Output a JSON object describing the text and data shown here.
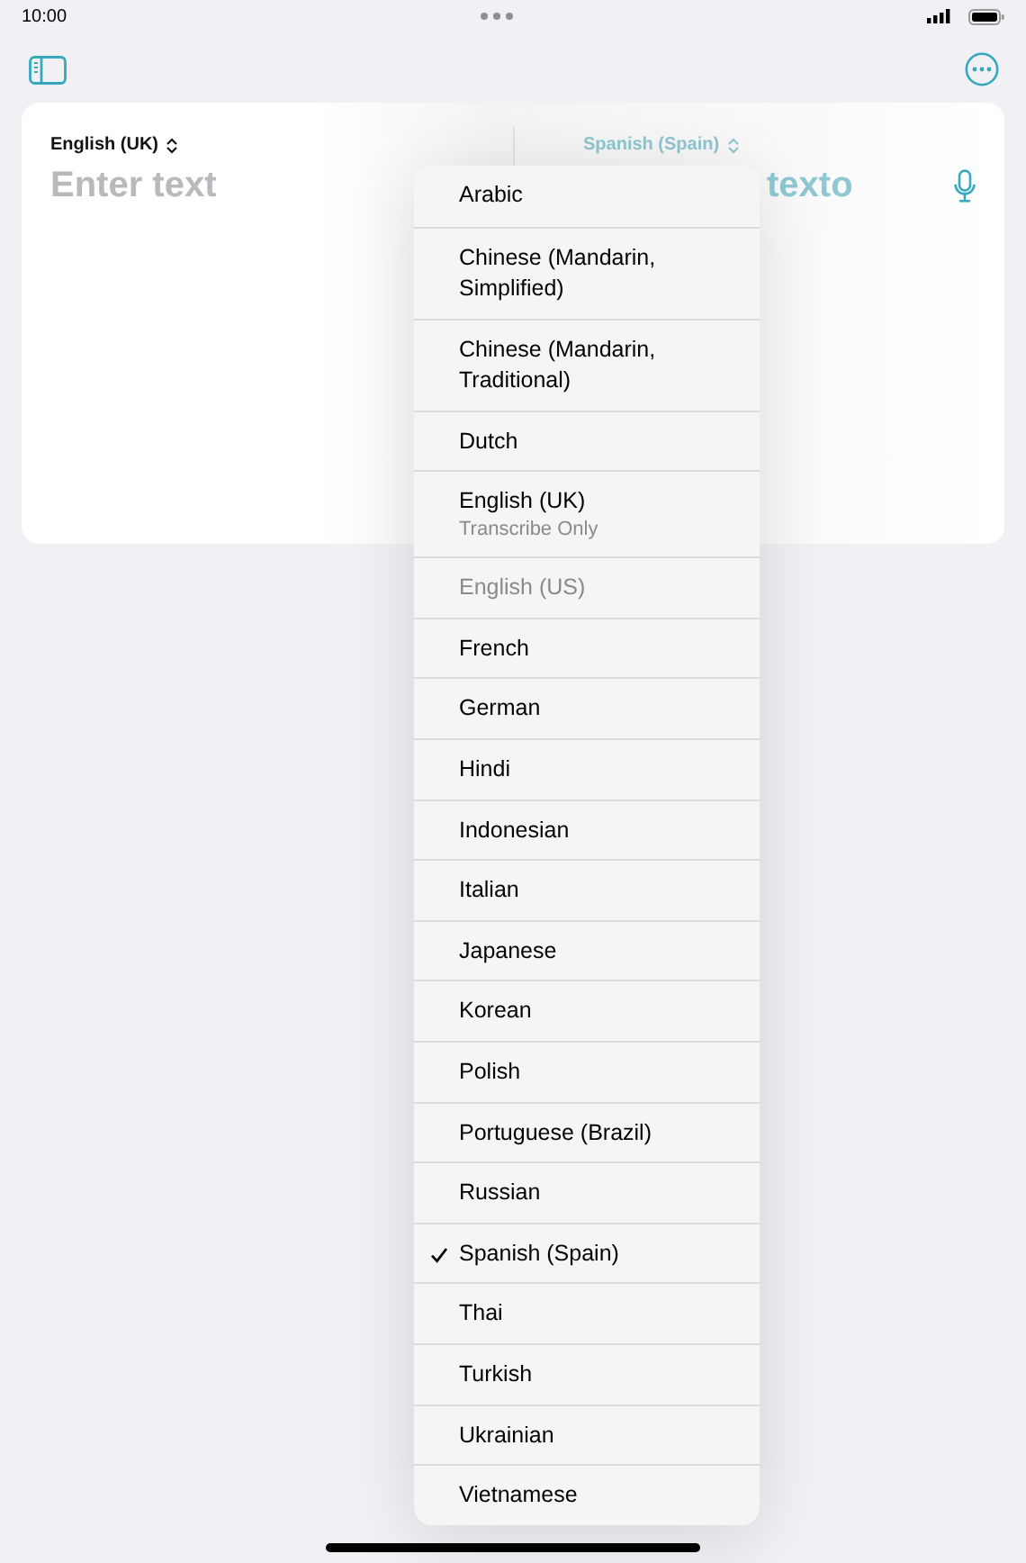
{
  "status_bar": {
    "time": "10:00"
  },
  "source": {
    "language": "English (UK)",
    "placeholder": "Enter text"
  },
  "target": {
    "language": "Spanish (Spain)",
    "text": "texto"
  },
  "menu": [
    {
      "label": "Arabic",
      "selected": false,
      "disabled": false
    },
    {
      "label": "Chinese (Mandarin, Simplified)",
      "selected": false,
      "disabled": false
    },
    {
      "label": "Chinese (Mandarin, Traditional)",
      "selected": false,
      "disabled": false
    },
    {
      "label": "Dutch",
      "selected": false,
      "disabled": false
    },
    {
      "label": "English (UK)",
      "sublabel": "Transcribe Only",
      "selected": false,
      "disabled": false
    },
    {
      "label": "English (US)",
      "selected": false,
      "disabled": true
    },
    {
      "label": "French",
      "selected": false,
      "disabled": false
    },
    {
      "label": "German",
      "selected": false,
      "disabled": false
    },
    {
      "label": "Hindi",
      "selected": false,
      "disabled": false
    },
    {
      "label": "Indonesian",
      "selected": false,
      "disabled": false
    },
    {
      "label": "Italian",
      "selected": false,
      "disabled": false
    },
    {
      "label": "Japanese",
      "selected": false,
      "disabled": false
    },
    {
      "label": "Korean",
      "selected": false,
      "disabled": false
    },
    {
      "label": "Polish",
      "selected": false,
      "disabled": false
    },
    {
      "label": "Portuguese (Brazil)",
      "selected": false,
      "disabled": false
    },
    {
      "label": "Russian",
      "selected": false,
      "disabled": false
    },
    {
      "label": "Spanish (Spain)",
      "selected": true,
      "disabled": false
    },
    {
      "label": "Thai",
      "selected": false,
      "disabled": false
    },
    {
      "label": "Turkish",
      "selected": false,
      "disabled": false
    },
    {
      "label": "Ukrainian",
      "selected": false,
      "disabled": false
    },
    {
      "label": "Vietnamese",
      "selected": false,
      "disabled": false
    }
  ]
}
